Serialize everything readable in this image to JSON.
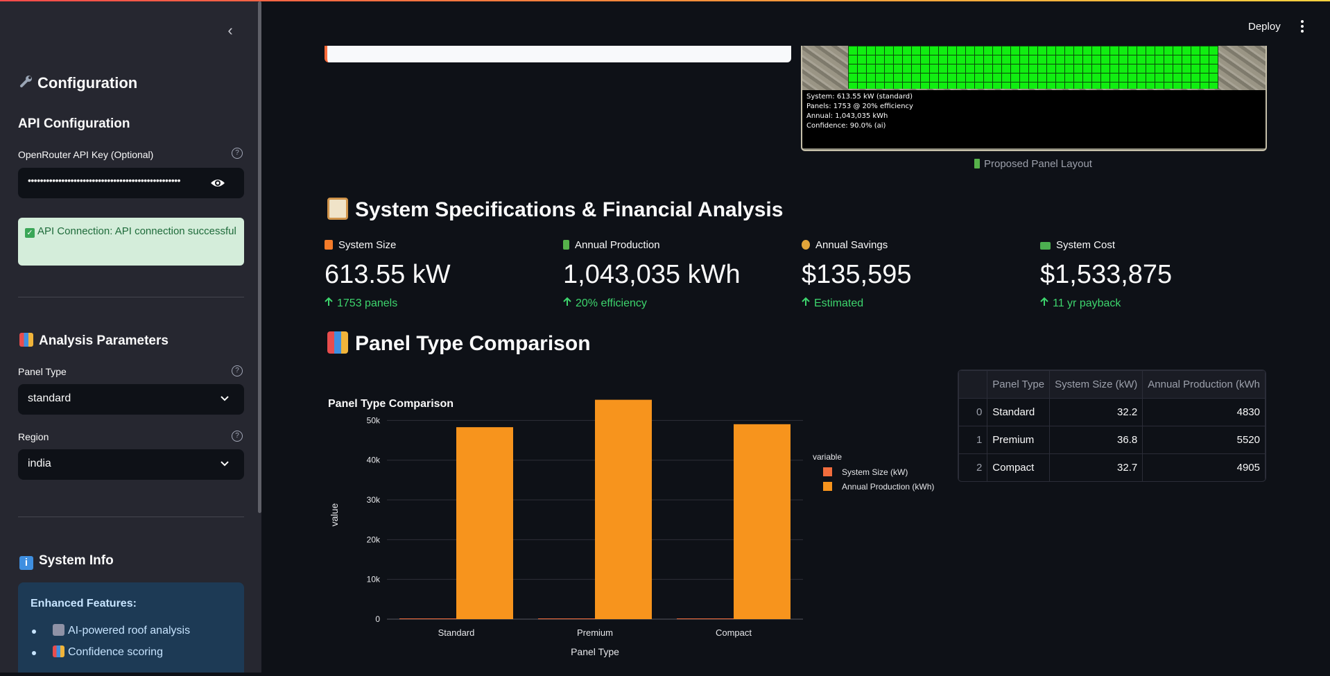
{
  "sidebar": {
    "collapse_glyph": "‹",
    "title": "Configuration",
    "api_section": "API Configuration",
    "api_key_label": "OpenRouter API Key (Optional)",
    "api_key_masked": "••••••••••••••••••••••••••••••••••••••••••••••••••",
    "api_status": "API Connection: API connection successful",
    "analysis_section": "Analysis Parameters",
    "panel_type_label": "Panel Type",
    "panel_type_value": "standard",
    "region_label": "Region",
    "region_value": "india",
    "system_info_section": "System Info",
    "features_title": "Enhanced Features:",
    "features": [
      "AI-powered roof analysis",
      "Confidence scoring"
    ]
  },
  "header": {
    "deploy": "Deploy"
  },
  "image": {
    "info_lines": [
      "System: 613.55 kW (standard)",
      "Panels: 1753 @ 20% efficiency",
      "Annual: 1,043,035 kWh",
      "Confidence: 90.0% (ai)"
    ],
    "caption": "Proposed Panel Layout"
  },
  "specs": {
    "title": "System Specifications & Financial Analysis",
    "metrics": [
      {
        "label": "System Size",
        "value": "613.55 kW",
        "delta": "1753 panels",
        "icon": "lightning-icon",
        "color": "#f57c2a"
      },
      {
        "label": "Annual Production",
        "value": "1,043,035 kWh",
        "delta": "20% efficiency",
        "icon": "battery-icon",
        "color": "#56b24a"
      },
      {
        "label": "Annual Savings",
        "value": "$135,595",
        "delta": "Estimated",
        "icon": "money-bag-icon",
        "color": "#e2a53a"
      },
      {
        "label": "System Cost",
        "value": "$1,533,875",
        "delta": "11 yr payback",
        "icon": "banknote-icon",
        "color": "#4caf50"
      }
    ]
  },
  "comparison": {
    "title": "Panel Type Comparison",
    "table": {
      "headers": [
        "",
        "Panel Type",
        "System Size (kW)",
        "Annual Production (kWh"
      ],
      "rows": [
        [
          "0",
          "Standard",
          "32.2",
          "4830"
        ],
        [
          "1",
          "Premium",
          "36.8",
          "5520"
        ],
        [
          "2",
          "Compact",
          "32.7",
          "4905"
        ]
      ]
    }
  },
  "chart_data": {
    "type": "bar",
    "title": "Panel Type Comparison",
    "xlabel": "Panel Type",
    "ylabel": "value",
    "categories": [
      "Standard",
      "Premium",
      "Compact"
    ],
    "series": [
      {
        "name": "System Size (kW)",
        "values": [
          32.2,
          36.8,
          32.7
        ],
        "color": "#f26d3d"
      },
      {
        "name": "Annual Production (kWh)",
        "values": [
          48300,
          55200,
          49050
        ],
        "color": "#f7941d"
      }
    ],
    "ylim": [
      0,
      56000
    ],
    "yticks": [
      0,
      10000,
      20000,
      30000,
      40000,
      50000
    ],
    "ytick_labels": [
      "0",
      "10k",
      "20k",
      "30k",
      "40k",
      "50k"
    ],
    "legend_title": "variable",
    "legend_position": "right",
    "grid": true
  },
  "colors": {
    "accent": "#ff4b4b",
    "success": "#3dd56d",
    "bg": "#0e1117",
    "sidebar": "#262730"
  }
}
